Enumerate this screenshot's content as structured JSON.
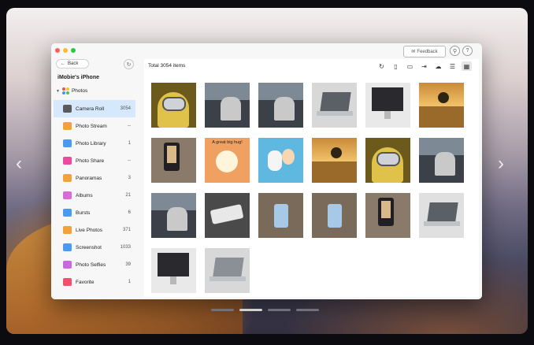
{
  "window": {
    "feedback_label": "Feedback",
    "search_icon": "search-icon",
    "help_icon": "help-icon"
  },
  "sidebar": {
    "back_label": "Back",
    "device_name": "iMobie's iPhone",
    "section_label": "Photos",
    "items": [
      {
        "label": "Camera Roll",
        "count": "3054",
        "icon": "camera-icon",
        "color": "#5a5a5a",
        "active": true
      },
      {
        "label": "Photo Stream",
        "count": "--",
        "icon": "photo-stream-icon",
        "color": "#f2a23a",
        "active": false
      },
      {
        "label": "Photo Library",
        "count": "1",
        "icon": "photo-library-icon",
        "color": "#4a9bf0",
        "active": false
      },
      {
        "label": "Photo Share",
        "count": "--",
        "icon": "share-icon",
        "color": "#ea4aa0",
        "active": false
      },
      {
        "label": "Panoramas",
        "count": "3",
        "icon": "panorama-icon",
        "color": "#f2a23a",
        "active": false
      },
      {
        "label": "Albums",
        "count": "21",
        "icon": "albums-icon",
        "color": "#d96bd6",
        "active": false
      },
      {
        "label": "Bursts",
        "count": "6",
        "icon": "bursts-icon",
        "color": "#4a9bf0",
        "active": false
      },
      {
        "label": "Live Photos",
        "count": "371",
        "icon": "live-photos-icon",
        "color": "#f2a23a",
        "active": false
      },
      {
        "label": "Screenshot",
        "count": "1033",
        "icon": "screenshot-icon",
        "color": "#4a9bf0",
        "active": false
      },
      {
        "label": "Photo Selfies",
        "count": "39",
        "icon": "selfie-icon",
        "color": "#c86adb",
        "active": false
      },
      {
        "label": "Favorite",
        "count": "1",
        "icon": "heart-icon",
        "color": "#f0506e",
        "active": false
      }
    ]
  },
  "main": {
    "total_label": "Total 3054 items",
    "toolbar": [
      "refresh-icon",
      "export-to-device-icon",
      "export-to-pc-icon",
      "import-icon",
      "upload-icon",
      "list-view-icon",
      "grid-view-icon"
    ]
  },
  "photos": [
    {
      "subject": "minion",
      "bg": "#6b5a1c",
      "fg": "#e0c24a"
    },
    {
      "subject": "cafe-man",
      "bg": "#3c4048",
      "fg": "#c9c9c9"
    },
    {
      "subject": "cafe-man",
      "bg": "#3c4048",
      "fg": "#c9c9c9"
    },
    {
      "subject": "macbook",
      "bg": "#d8d8d8",
      "fg": "#5b5f66"
    },
    {
      "subject": "imac",
      "bg": "#e9e9e9",
      "fg": "#2a2a2e"
    },
    {
      "subject": "tree-field",
      "bg": "#9a6a2a",
      "fg": "#2e2414"
    },
    {
      "subject": "phone-hand",
      "bg": "#8a7a6a",
      "fg": "#1f1f24"
    },
    {
      "subject": "cartoon-hug",
      "bg": "#f0a060",
      "fg": "#fff5d8",
      "caption": "A great big hug!"
    },
    {
      "subject": "snoopy",
      "bg": "#5fb8e0",
      "fg": "#f5f5f5"
    },
    {
      "subject": "tree-field",
      "bg": "#9a6a2a",
      "fg": "#2e2414"
    },
    {
      "subject": "minion",
      "bg": "#6b5a1c",
      "fg": "#e0c24a"
    },
    {
      "subject": "cafe-man",
      "bg": "#3c4048",
      "fg": "#c9c9c9"
    },
    {
      "subject": "cafe-man",
      "bg": "#3c4048",
      "fg": "#c9c9c9"
    },
    {
      "subject": "phone-table",
      "bg": "#4a4a4a",
      "fg": "#e8e8e8"
    },
    {
      "subject": "phone-hold",
      "bg": "#7a6a5a",
      "fg": "#a8c8e8"
    },
    {
      "subject": "phone-hold",
      "bg": "#7a6a5a",
      "fg": "#a8c8e8"
    },
    {
      "subject": "phone-hand",
      "bg": "#8a7a6a",
      "fg": "#1f1f24"
    },
    {
      "subject": "macbook",
      "bg": "#e0e0e0",
      "fg": "#5b5f66"
    },
    {
      "subject": "imac",
      "bg": "#e9e9e9",
      "fg": "#2a2a2e"
    },
    {
      "subject": "macbook",
      "bg": "#d8d8d8",
      "fg": "#8b8f96"
    }
  ],
  "pagination": {
    "pages": 4,
    "active": 1
  }
}
